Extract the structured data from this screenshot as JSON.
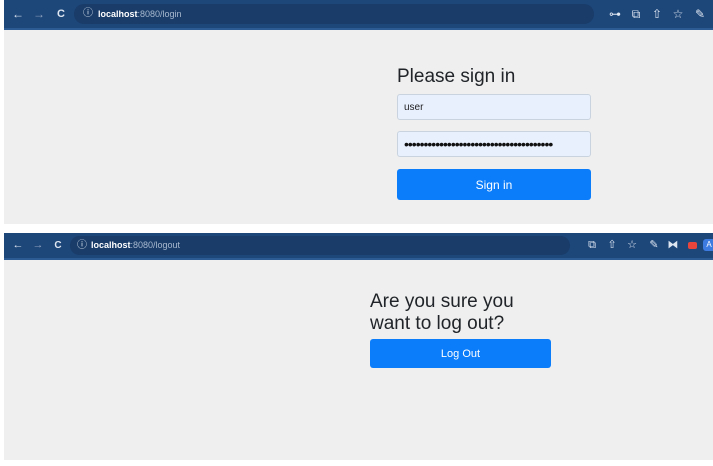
{
  "login_window": {
    "toolbar": {
      "back_icon": "←",
      "forward_icon": "→",
      "reload_icon": "C",
      "info_icon": "ⓘ",
      "url_host": "localhost",
      "url_path": ":8080/login",
      "key_icon": "⊶",
      "translate_icon": "⧉",
      "share_icon": "⇧",
      "star_icon": "☆",
      "pen_icon": "✎"
    },
    "form": {
      "heading": "Please sign in",
      "username_value": "user",
      "password_mask": "••••••••••••••••••••••••••••••••••••••",
      "submit_label": "Sign in"
    }
  },
  "logout_window": {
    "toolbar": {
      "back_icon": "←",
      "forward_icon": "→",
      "reload_icon": "C",
      "info_icon": "ⓘ",
      "url_host": "localhost",
      "url_path": ":8080/logout",
      "translate_icon": "⧉",
      "share_icon": "⇧",
      "star_icon": "☆",
      "pen_icon": "✎",
      "ext_icon": "⧓",
      "ext_letter": "A"
    },
    "confirm": {
      "heading_line1": "Are you sure you",
      "heading_line2": "want to log out?",
      "button_label": "Log Out"
    }
  },
  "colors": {
    "toolbar": "#1d4679",
    "page_bg": "#efefef",
    "primary_button": "#0b7dfb",
    "autofill_bg": "#e8f0fe"
  }
}
